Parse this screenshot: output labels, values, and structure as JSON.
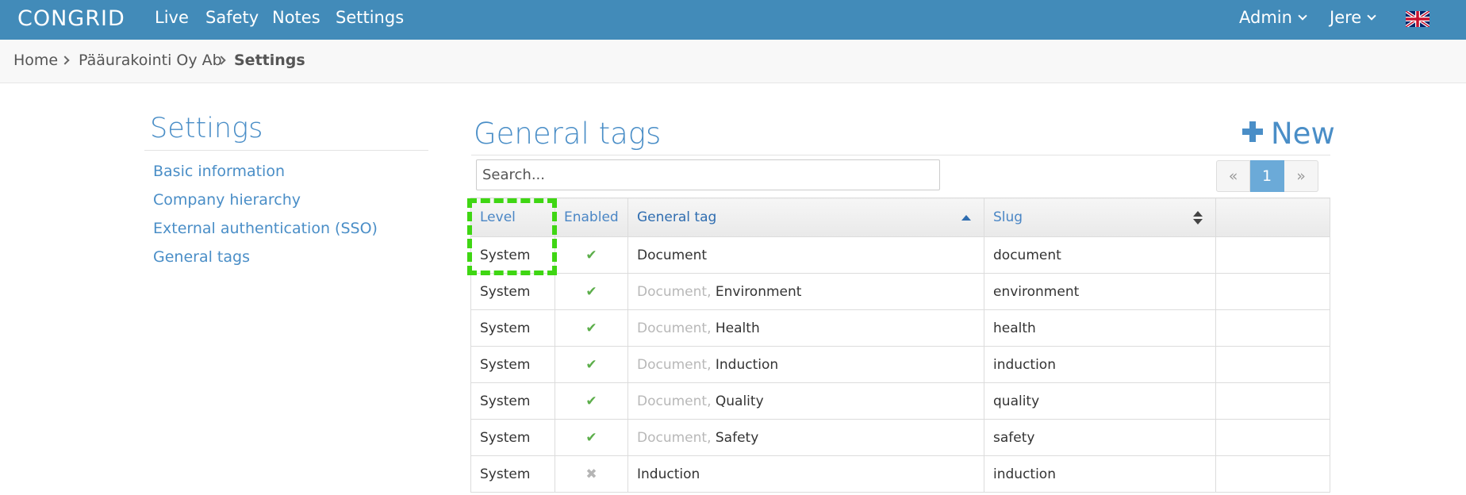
{
  "navbar": {
    "logo": "CONGRID",
    "links": [
      "Live",
      "Safety",
      "Notes",
      "Settings"
    ],
    "admin_label": "Admin",
    "user_label": "Jere",
    "language_flag": "uk-flag-icon"
  },
  "breadcrumb": {
    "home": "Home",
    "company": "Pääurakointi Oy Ab",
    "current": "Settings"
  },
  "sidebar": {
    "title": "Settings",
    "items": [
      {
        "label": "Basic information"
      },
      {
        "label": "Company hierarchy"
      },
      {
        "label": "External authentication (SSO)"
      },
      {
        "label": "General tags"
      }
    ]
  },
  "main": {
    "title": "General tags",
    "new_label": "New",
    "search_placeholder": "Search...",
    "pager": {
      "prev": "«",
      "current": "1",
      "next": "»"
    },
    "columns": [
      "Level",
      "Enabled",
      "General tag",
      "Slug"
    ],
    "rows": [
      {
        "level": "System",
        "enabled": true,
        "parent": "",
        "tag": "Document",
        "slug": "document"
      },
      {
        "level": "System",
        "enabled": true,
        "parent": "Document,",
        "tag": "Environment",
        "slug": "environment"
      },
      {
        "level": "System",
        "enabled": true,
        "parent": "Document,",
        "tag": "Health",
        "slug": "health"
      },
      {
        "level": "System",
        "enabled": true,
        "parent": "Document,",
        "tag": "Induction",
        "slug": "induction"
      },
      {
        "level": "System",
        "enabled": true,
        "parent": "Document,",
        "tag": "Quality",
        "slug": "quality"
      },
      {
        "level": "System",
        "enabled": true,
        "parent": "Document,",
        "tag": "Safety",
        "slug": "safety"
      },
      {
        "level": "System",
        "enabled": false,
        "parent": "",
        "tag": "Induction",
        "slug": "induction"
      }
    ]
  },
  "colors": {
    "navbar": "#428bb9",
    "accent": "#4a8ec7",
    "enabled": "#5cae4a",
    "disabled": "#b5b5b5",
    "highlight": "#3fd613"
  }
}
